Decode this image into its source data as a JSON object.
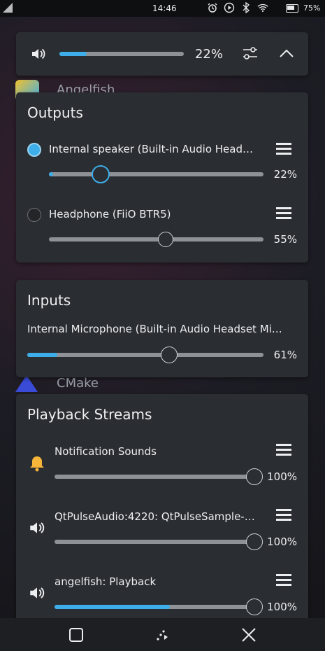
{
  "status_bar": {
    "time": "14:46",
    "battery_percent": "75%",
    "icons": [
      "signal-icon",
      "alarm-icon",
      "play-circle-icon",
      "bluetooth-icon",
      "wifi-icon",
      "battery-icon"
    ]
  },
  "background": {
    "apps": [
      "Angelfish",
      "CMake"
    ]
  },
  "master": {
    "volume_label": "22%",
    "volume_value": 0.22,
    "accent": "#3daee9"
  },
  "outputs": {
    "title": "Outputs",
    "devices": [
      {
        "label": "Internal speaker (Built-in Audio Head…",
        "selected": true,
        "volume_label": "22%",
        "volume": 0.22
      },
      {
        "label": "Headphone (FiiO BTR5)",
        "selected": false,
        "volume_label": "55%",
        "volume": 0.55
      }
    ]
  },
  "inputs": {
    "title": "Inputs",
    "devices": [
      {
        "label": "Internal Microphone (Built-in Audio Headset Mi…",
        "volume_label": "61%",
        "volume": 0.61,
        "level": 0.14
      }
    ]
  },
  "playback": {
    "title": "Playback Streams",
    "streams": [
      {
        "label": "Notification Sounds",
        "icon": "bell-icon",
        "volume_label": "100%",
        "volume": 1.0,
        "level": 0
      },
      {
        "label": "QtPulseAudio:4220: QtPulseSample-…",
        "icon": "speaker-icon",
        "volume_label": "100%",
        "volume": 1.0,
        "level": 0
      },
      {
        "label": "angelfish: Playback",
        "icon": "speaker-icon",
        "volume_label": "100%",
        "volume": 1.0,
        "level": 0.55
      }
    ]
  },
  "navbar": {
    "buttons": [
      "task-switcher-icon",
      "home-icon",
      "close-icon"
    ]
  }
}
